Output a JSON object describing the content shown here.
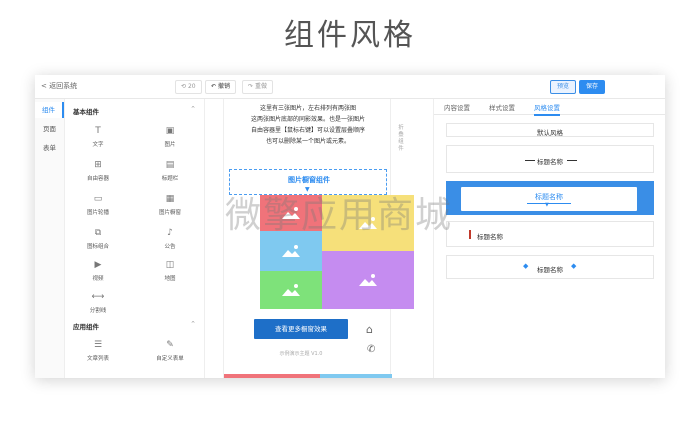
{
  "heading": "组件风格",
  "watermark": "微擎应用商城",
  "topbar": {
    "back_label": "< 返回系统",
    "history_count": "20",
    "undo_label": "撤销",
    "redo_label": "重做",
    "preview_label": "预览",
    "save_label": "保存"
  },
  "nav": {
    "items": [
      {
        "label": "组件",
        "active": true
      },
      {
        "label": "页面",
        "active": false
      },
      {
        "label": "表单",
        "active": false
      }
    ]
  },
  "components": {
    "basic_title": "基本组件",
    "basic": [
      {
        "label": "文字",
        "icon": "text-icon"
      },
      {
        "label": "图片",
        "icon": "image-icon"
      },
      {
        "label": "自由容器",
        "icon": "container-icon"
      },
      {
        "label": "标题栏",
        "icon": "title-bar-icon"
      },
      {
        "label": "图片轮播",
        "icon": "carousel-icon"
      },
      {
        "label": "图片橱窗",
        "icon": "image-window-icon"
      },
      {
        "label": "图标组合",
        "icon": "icon-group-icon"
      },
      {
        "label": "公告",
        "icon": "announcement-icon"
      },
      {
        "label": "视频",
        "icon": "video-icon"
      },
      {
        "label": "地图",
        "icon": "map-icon"
      },
      {
        "label": "分割线",
        "icon": "divider-icon"
      }
    ],
    "app_title": "应用组件",
    "app": [
      {
        "label": "文章列表",
        "icon": "article-list-icon"
      },
      {
        "label": "自定义表单",
        "icon": "custom-form-icon"
      }
    ]
  },
  "phone": {
    "intro_lines": [
      "这里有三张图片，左右排列有两张图",
      "这两张图片底部的同影效果。也是一张图片",
      "自由容器里【鼠标右键】可以设置层叠顺序",
      "也可以删除某一个图片或元素。"
    ],
    "group_title": "图片橱窗组件",
    "tiles": [
      {
        "color": "#f0737a"
      },
      {
        "color": "#f6e07a"
      },
      {
        "color": "#7fc9f0"
      },
      {
        "color": "#7ee27a"
      },
      {
        "color": "#c58cf0"
      }
    ],
    "cta_label": "查看更多橱窗效果",
    "version": "示例演示主题 V1.0",
    "strip_colors": [
      "#f0737a",
      "#7fc9f0"
    ]
  },
  "side_tab": "折叠组件",
  "settings": {
    "tabs": [
      {
        "label": "内容设置",
        "active": false
      },
      {
        "label": "样式设置",
        "active": false
      },
      {
        "label": "风格设置",
        "active": true
      }
    ],
    "styles": [
      {
        "label": "默认风格"
      },
      {
        "label": "标题名称"
      },
      {
        "label": "标题名称"
      },
      {
        "label": "标题名称"
      },
      {
        "label": "标题名称"
      }
    ]
  },
  "colors": {
    "accent": "#2d8cf0",
    "selected_card": "#3a8ee6"
  }
}
